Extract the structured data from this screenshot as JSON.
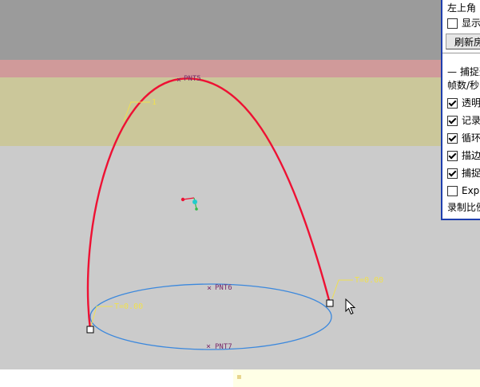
{
  "panel": {
    "corner_label": "左上角",
    "show_checkbox": {
      "label": "显示",
      "checked": false
    },
    "refresh_button": "刷新房",
    "section_label": "捕捉选",
    "fps_label": "帧数/秒",
    "options": [
      {
        "label": "透明",
        "checked": true
      },
      {
        "label": "记录",
        "checked": true
      },
      {
        "label": "循环",
        "checked": true
      },
      {
        "label": "描边",
        "checked": true
      },
      {
        "label": "捕捉",
        "checked": true
      },
      {
        "label": "Exp",
        "checked": false
      }
    ],
    "footer": "录制比例"
  },
  "viewport": {
    "points": {
      "top": "PNT5",
      "front": "PNT6",
      "back": "PNT7"
    },
    "annotations": {
      "arc_label": "1",
      "right_t": "T=0.00",
      "left_t": "T=0.00"
    }
  },
  "colors": {
    "arc": "#ee1133",
    "ellipse": "#3b88dd",
    "datum": "#7a2a6a",
    "annotation": "#f0e050"
  }
}
